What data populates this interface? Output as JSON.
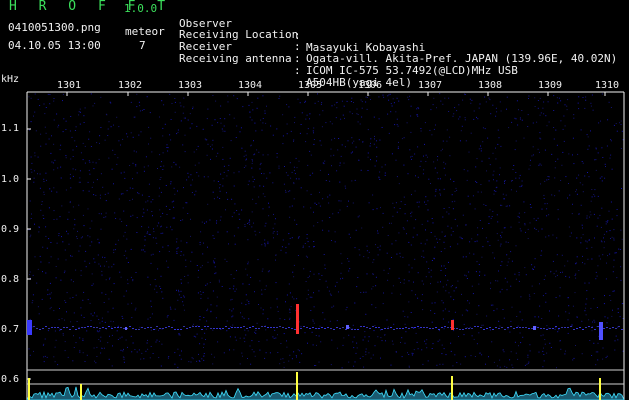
{
  "header": {
    "app_title": "H R O F F T",
    "app_version": "1.0.0",
    "file_name": "0410051300.png",
    "datetime": "04.10.05 13:00",
    "meteor_label": "meteor",
    "meteor_count": "7"
  },
  "metadata": [
    {
      "key": "Observer",
      "value": "Masayuki Kobayashi"
    },
    {
      "key": "Receiving Location",
      "value": "Ogata-vill. Akita-Pref. JAPAN (139.96E, 40.02N)"
    },
    {
      "key": "Receiver",
      "value": "ICOM IC-575 53.7492(@LCD)MHz USB"
    },
    {
      "key": "Receiving antenna",
      "value": "A504HB(yagi 4el)"
    }
  ],
  "separator": ":",
  "plot": {
    "y_unit": "kHz",
    "y_ticks": [
      "1.1",
      "1.0",
      "0.9",
      "0.8",
      "0.7",
      "0.6"
    ],
    "x_ticks": [
      "1301",
      "1302",
      "1303",
      "1304",
      "1305",
      "1306",
      "1307",
      "1308",
      "1309",
      "1310"
    ],
    "colors": {
      "background": "#000000",
      "text": "#f2f2f2",
      "accent": "#39e05a",
      "noise": "#1a1a8c",
      "signal": "#ff3030",
      "spectrum": "#40e0ff",
      "marker": "#ffff40"
    }
  }
}
